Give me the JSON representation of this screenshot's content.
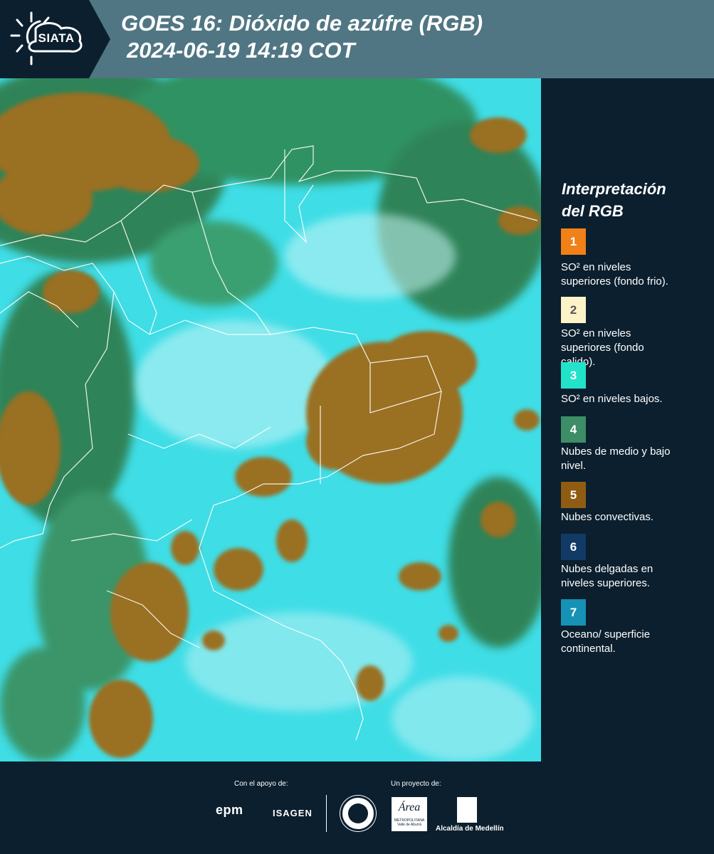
{
  "header": {
    "logo_text": "SIATA",
    "title_line1": "GOES 16: Dióxido de azúfre (RGB)",
    "title_line2": "2024-06-19 14:19 COT"
  },
  "legend": {
    "title_line1": "Interpretación",
    "title_line2": "del RGB",
    "items": [
      {
        "number": "1",
        "color": "#f08018",
        "text_line1": "SO² en niveles",
        "text_line2": "superiores (fondo frio)."
      },
      {
        "number": "2",
        "color": "#fcf3c8",
        "text_line1": "SO² en niveles",
        "text_line2": "superiores (fondo",
        "text_line3": "calido)."
      },
      {
        "number": "3",
        "color": "#22e3c9",
        "text_line1": "SO² en niveles bajos."
      },
      {
        "number": "4",
        "color": "#3d8d67",
        "text_line1": "Nubes de medio y bajo",
        "text_line2": "nivel."
      },
      {
        "number": "5",
        "color": "#8e5c12",
        "text_line1": "Nubes convectivas."
      },
      {
        "number": "6",
        "color": "#123a66",
        "text_line1": "Nubes delgadas en",
        "text_line2": "niveles superiores."
      },
      {
        "number": "7",
        "color": "#1592b5",
        "text_line1": "Oceano/ superficie",
        "text_line2": "continental."
      }
    ]
  },
  "footer": {
    "support_label": "Con el apoyo de:",
    "project_label": "Un proyecto de:",
    "epm": "epm",
    "isagen": "ISAGEN",
    "area_word": "Área",
    "area_sub": "METROPOLITANA Valle de Aburrá",
    "alcaldia": "Alcaldía de Medellín"
  },
  "colors": {
    "header_bg": "#507683",
    "panel_bg": "#0b1f2e",
    "map_cyan": "#3fdde6",
    "map_brown": "#9a6f22",
    "map_green": "#2e7a4a"
  }
}
